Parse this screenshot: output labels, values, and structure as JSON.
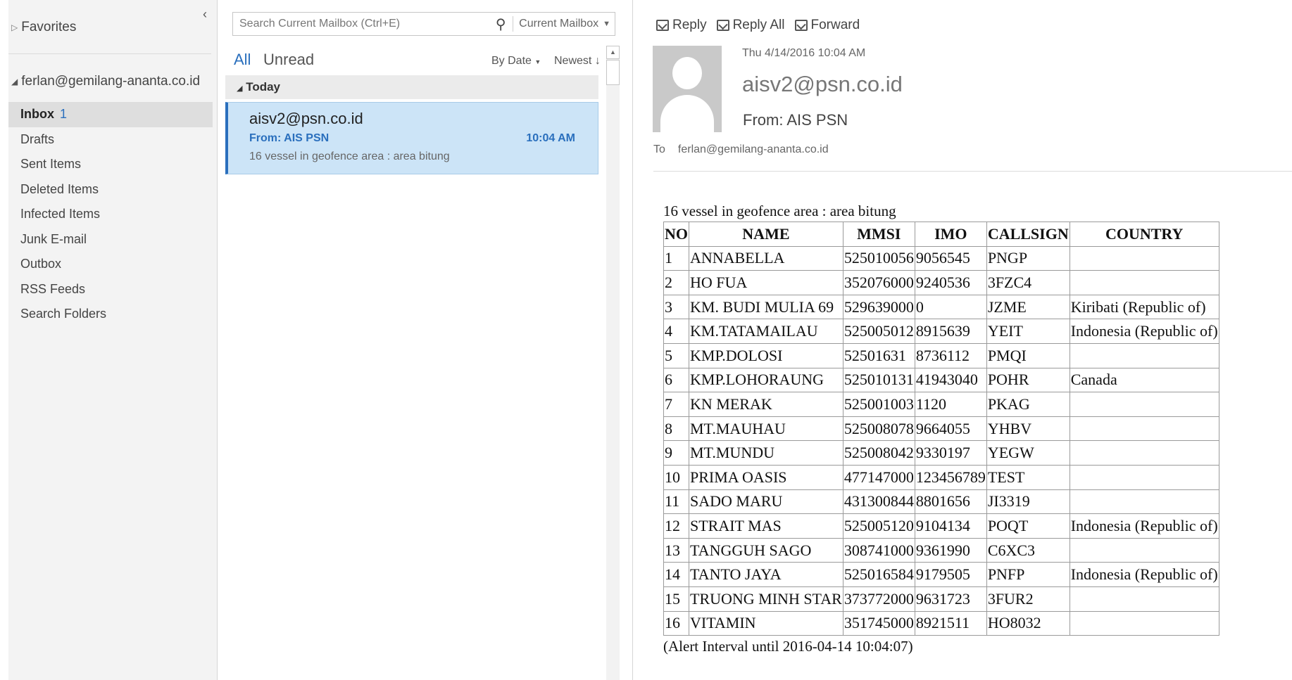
{
  "folders": {
    "favorites": "Favorites",
    "account": "ferlan@gemilang-ananta.co.id",
    "items": [
      {
        "label": "Inbox",
        "count": "1"
      },
      {
        "label": "Drafts",
        "count": ""
      },
      {
        "label": "Sent Items",
        "count": ""
      },
      {
        "label": "Deleted Items",
        "count": ""
      },
      {
        "label": "Infected Items",
        "count": ""
      },
      {
        "label": "Junk E-mail",
        "count": ""
      },
      {
        "label": "Outbox",
        "count": ""
      },
      {
        "label": "RSS Feeds",
        "count": ""
      },
      {
        "label": "Search Folders",
        "count": ""
      }
    ]
  },
  "search": {
    "placeholder": "Search Current Mailbox (Ctrl+E)",
    "scope": "Current Mailbox"
  },
  "filters": {
    "all": "All",
    "unread": "Unread",
    "sort_by": "By Date",
    "order": "Newest"
  },
  "group": {
    "label": "Today"
  },
  "message": {
    "sender": "aisv2@psn.co.id",
    "from": "From: AIS PSN",
    "time": "10:04 AM",
    "preview": "16 vessel in geofence area : area bitung"
  },
  "reading": {
    "actions": {
      "reply": "Reply",
      "reply_all": "Reply All",
      "forward": "Forward"
    },
    "date": "Thu 4/14/2016 10:04 AM",
    "sender": "aisv2@psn.co.id",
    "from": "From: AIS PSN",
    "to_label": "To",
    "to": "ferlan@gemilang-ananta.co.id",
    "subject": "16 vessel in geofence area : area bitung",
    "footer": "(Alert Interval until 2016-04-14 10:04:07)",
    "columns": [
      "NO",
      "NAME",
      "MMSI",
      "IMO",
      "CALLSIGN",
      "COUNTRY"
    ],
    "rows": [
      [
        "1",
        "ANNABELLA",
        "525010056",
        "9056545",
        "PNGP",
        ""
      ],
      [
        "2",
        "HO FUA",
        "352076000",
        "9240536",
        "3FZC4",
        ""
      ],
      [
        "3",
        "KM. BUDI MULIA 69",
        "529639000",
        "0",
        "JZME",
        "Kiribati (Republic of)"
      ],
      [
        "4",
        "KM.TATAMAILAU",
        "525005012",
        "8915639",
        "YEIT",
        "Indonesia (Republic of)"
      ],
      [
        "5",
        "KMP.DOLOSI",
        "52501631",
        "8736112",
        "PMQI",
        ""
      ],
      [
        "6",
        "KMP.LOHORAUNG",
        "525010131",
        "41943040",
        "POHR",
        "Canada"
      ],
      [
        "7",
        "KN MERAK",
        "525001003",
        "1120",
        "PKAG",
        ""
      ],
      [
        "8",
        "MT.MAUHAU",
        "525008078",
        "9664055",
        "YHBV",
        ""
      ],
      [
        "9",
        "MT.MUNDU",
        "525008042",
        "9330197",
        "YEGW",
        ""
      ],
      [
        "10",
        "PRIMA OASIS",
        "477147000",
        "123456789",
        "TEST",
        ""
      ],
      [
        "11",
        "SADO MARU",
        "431300844",
        "8801656",
        "JI3319",
        ""
      ],
      [
        "12",
        "STRAIT MAS",
        "525005120",
        "9104134",
        "POQT",
        "Indonesia (Republic of)"
      ],
      [
        "13",
        "TANGGUH SAGO",
        "308741000",
        "9361990",
        "C6XC3",
        ""
      ],
      [
        "14",
        "TANTO JAYA",
        "525016584",
        "9179505",
        "PNFP",
        "Indonesia (Republic of)"
      ],
      [
        "15",
        "TRUONG MINH STAR",
        "373772000",
        "9631723",
        "3FUR2",
        ""
      ],
      [
        "16",
        "VITAMIN",
        "351745000",
        "8921511",
        "HO8032",
        ""
      ]
    ]
  }
}
